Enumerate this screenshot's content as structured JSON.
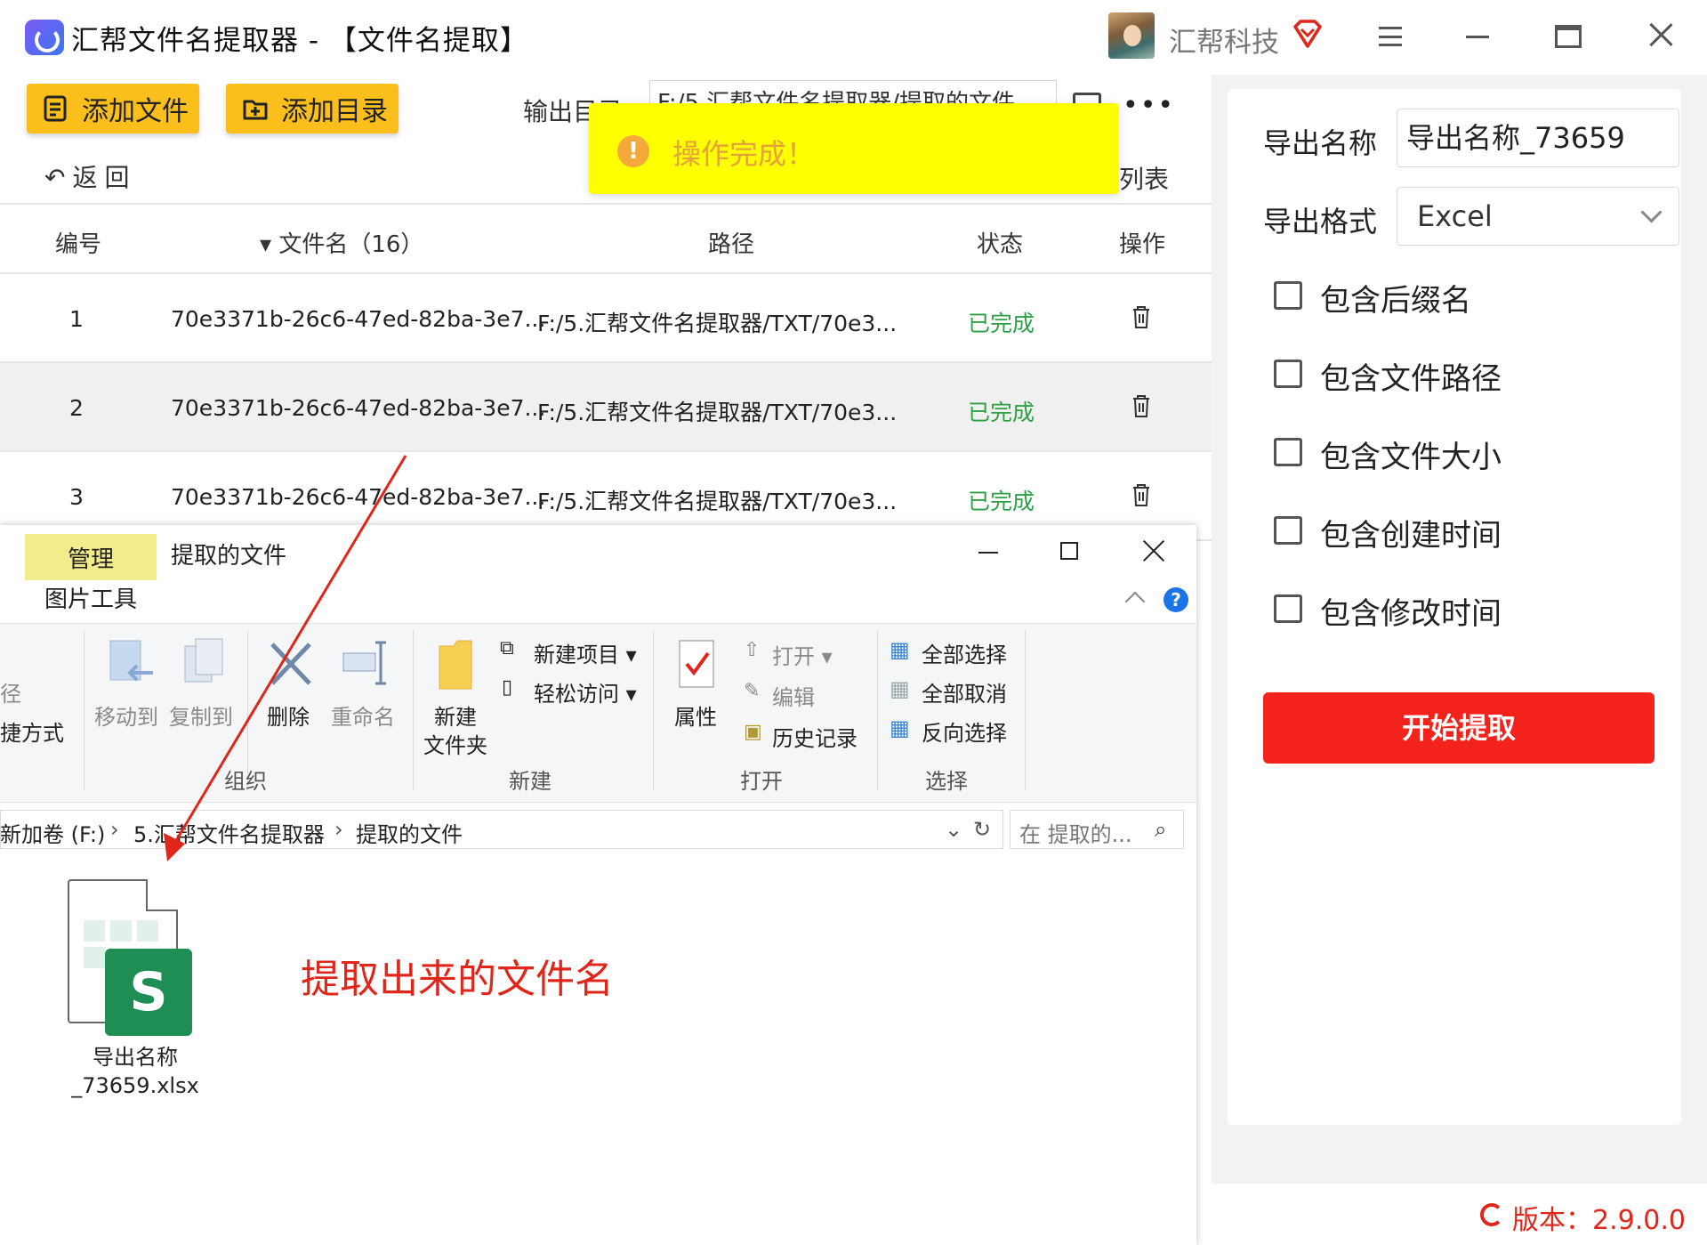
{
  "app": {
    "title": "汇帮文件名提取器 - 【文件名提取】",
    "company": "汇帮科技",
    "version": "版本：2.9.0.0"
  },
  "toolbar": {
    "add_file": "添加文件",
    "add_dir": "添加目录",
    "output_dir_label": "输出目录：",
    "output_dir_value": "F:/5.汇帮文件名提取器/提取的文件",
    "back": "返回",
    "list_tail": "列表"
  },
  "toast": {
    "message": "操作完成！",
    "icon": "!"
  },
  "table": {
    "headers": [
      "编号",
      "▾ 文件名（16）",
      "路径",
      "状态",
      "操作"
    ],
    "rows": [
      {
        "no": "1",
        "name": "70e3371b-26c6-47ed-82ba-3e7...",
        "path": "F:/5.汇帮文件名提取器/TXT/70e3...",
        "status": "已完成"
      },
      {
        "no": "2",
        "name": "70e3371b-26c6-47ed-82ba-3e7...",
        "path": "F:/5.汇帮文件名提取器/TXT/70e3...",
        "status": "已完成"
      },
      {
        "no": "3",
        "name": "70e3371b-26c6-47ed-82ba-3e7...",
        "path": "F:/5.汇帮文件名提取器/TXT/70e3...",
        "status": "已完成"
      }
    ]
  },
  "settings": {
    "export_name_label": "导出名称",
    "export_name_value": "导出名称_73659",
    "export_format_label": "导出格式",
    "export_format_value": "Excel",
    "options": [
      "包含后缀名",
      "包含文件路径",
      "包含文件大小",
      "包含创建时间",
      "包含修改时间"
    ],
    "start_button": "开始提取"
  },
  "explorer": {
    "tab_manage": "管理",
    "tab_picture_tools": "图片工具",
    "title": "提取的文件",
    "ribbon": {
      "cut_path": "径",
      "cut_shortcut": "捷方式",
      "move_to": "移动到",
      "copy_to": "复制到",
      "delete": "删除",
      "rename": "重命名",
      "new_folder_1": "新建",
      "new_folder_2": "文件夹",
      "new_item": "新建项目",
      "easy_access": "轻松访问",
      "properties": "属性",
      "open": "打开",
      "edit": "编辑",
      "history": "历史记录",
      "select_all": "全部选择",
      "select_none": "全部取消",
      "invert_selection": "反向选择",
      "group_organize": "组织",
      "group_new": "新建",
      "group_open": "打开",
      "group_select": "选择"
    },
    "address": [
      "新加卷 (F:)",
      "5.汇帮文件名提取器",
      "提取的文件"
    ],
    "search_placeholder": "在 提取的...",
    "file_name_line1": "导出名称",
    "file_name_line2": "_73659.xlsx"
  },
  "annotation": "提取出来的文件名",
  "colors": {
    "accent_yellow": "#fbbf1c",
    "start_red": "#f3221a",
    "status_green": "#2ea043",
    "annotation_red": "#e0251b",
    "toast_bg": "#ffff00"
  }
}
